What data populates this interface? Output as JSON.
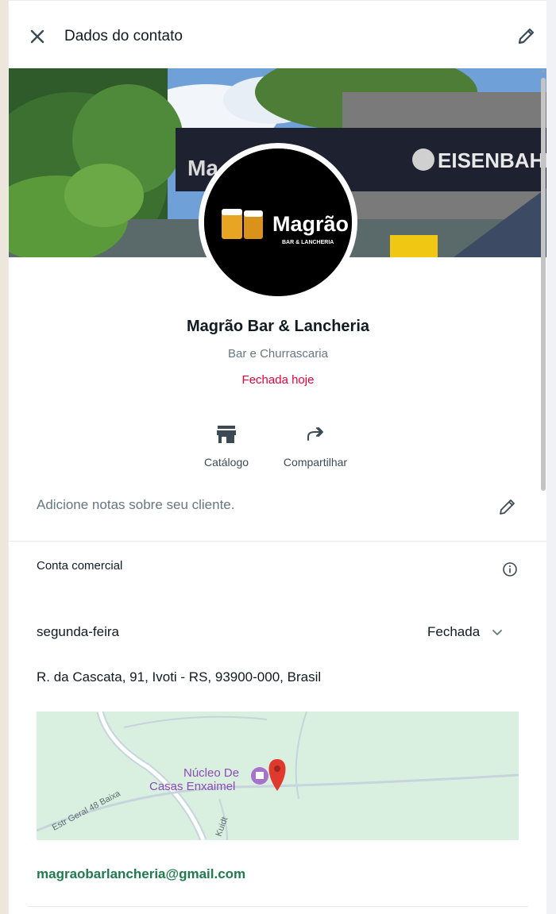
{
  "header": {
    "title": "Dados do contato",
    "close_icon": "close-icon",
    "edit_icon": "pencil-icon"
  },
  "cover": {
    "sign_left": "Ma",
    "sign_right": "EISENBAHN"
  },
  "profile": {
    "logo_text": "Magrão",
    "logo_sub": "BAR & LANCHERIA",
    "name": "Magrão Bar & Lancheria",
    "category": "Bar e Churrascaria",
    "status": "Fechada hoje"
  },
  "actions": {
    "catalog_label": "Catálogo",
    "share_label": "Compartilhar"
  },
  "notes": {
    "placeholder": "Adicione notas sobre seu cliente."
  },
  "business": {
    "title": "Conta comercial",
    "day": "segunda-feira",
    "day_status": "Fechada",
    "address": "R. da Cascata, 91, Ivoti - RS, 93900-000, Brasil",
    "email": "magraobarlancheria@gmail.com"
  },
  "map": {
    "poi_line1": "Núcleo De",
    "poi_line2": "Casas Enxaimel",
    "road_label": "Estr Geral 48 Baixa",
    "road_label2": "Kuidt"
  },
  "colors": {
    "status_red": "#ea0038",
    "email_green": "#1f7b4d",
    "map_bg": "#d9f0e1"
  }
}
